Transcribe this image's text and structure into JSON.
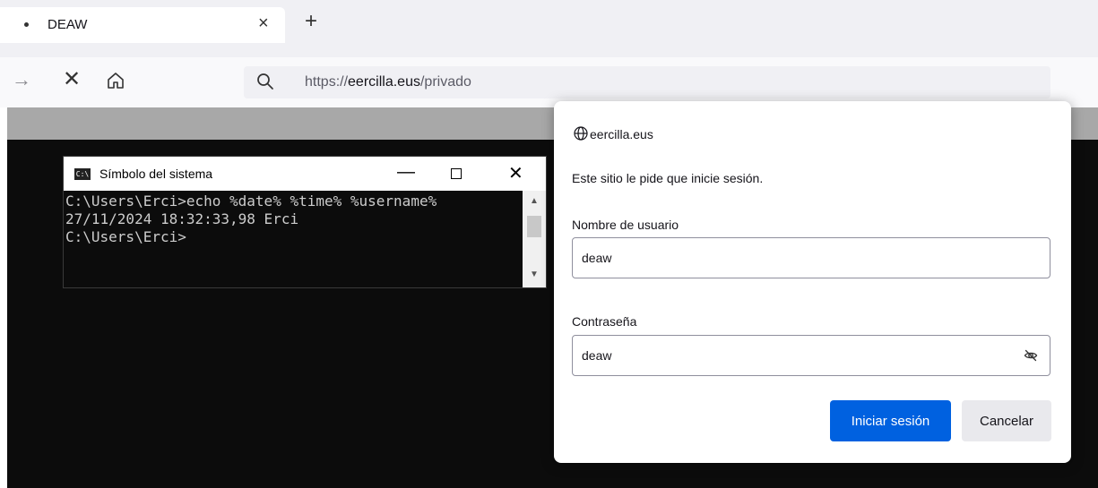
{
  "browser": {
    "tab": {
      "title": "DEAW",
      "close_glyph": "×"
    },
    "new_tab_glyph": "+",
    "nav": {
      "forward_glyph": "→",
      "stop_glyph": "✕"
    },
    "url": {
      "scheme": "https://",
      "host": "eercilla.eus",
      "path": "/privado"
    }
  },
  "cmd_window": {
    "title": "Símbolo del sistema",
    "icon_text": "C:\\",
    "minimize_glyph": "—",
    "close_glyph": "✕",
    "lines": [
      "C:\\Users\\Erci>echo %date% %time% %username%",
      "27/11/2024 18:32:33,98 Erci",
      "",
      "C:\\Users\\Erci>"
    ],
    "scroll_up_glyph": "▲",
    "scroll_down_glyph": "▼"
  },
  "auth_dialog": {
    "host": "eercilla.eus",
    "message": "Este sitio le pide que inicie sesión.",
    "username_label": "Nombre de usuario",
    "username_value": "deaw",
    "password_label": "Contraseña",
    "password_value": "deaw",
    "submit_label": "Iniciar sesión",
    "cancel_label": "Cancelar"
  },
  "colors": {
    "primary_button": "#0061e0",
    "terminal_bg": "#0c0c0c",
    "terminal_text": "#cccccc"
  },
  "icons": [
    "tab-dot-icon",
    "close-icon",
    "plus-icon",
    "forward-arrow-icon",
    "stop-icon",
    "home-icon",
    "search-icon",
    "globe-icon",
    "cmd-app-icon",
    "minimize-icon",
    "maximize-icon",
    "eye-slash-icon"
  ]
}
